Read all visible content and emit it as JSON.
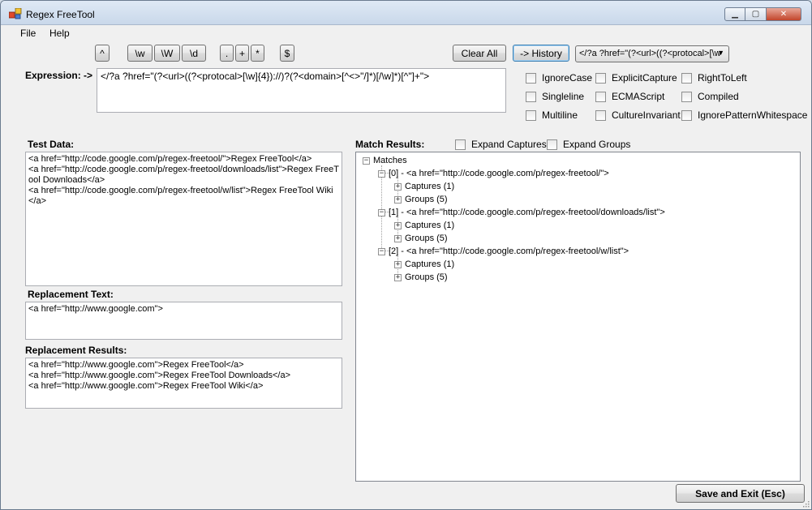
{
  "window": {
    "title": "Regex FreeTool"
  },
  "menu": {
    "file": "File",
    "help": "Help"
  },
  "toolbar": {
    "caret": "^",
    "word": "\\w",
    "nonword": "\\W",
    "digit": "\\d",
    "dot": ".",
    "plus": "+",
    "star": "*",
    "dollar": "$",
    "clear_all": "Clear All",
    "history": "-> History",
    "history_value": "</?a ?href=\"(?<url>((?<protocal>[\\w"
  },
  "expression": {
    "label": "Expression: ->",
    "value": "</?a ?href=\"(?<url>((?<protocal>[\\w]{4})://)?(?<domain>[^<>\"/]*)[/\\w]*)[^\"]+\">"
  },
  "options": {
    "ignore_case": "IgnoreCase",
    "explicit_capture": "ExplicitCapture",
    "right_to_left": "RightToLeft",
    "singleline": "Singleline",
    "ecmascript": "ECMAScript",
    "compiled": "Compiled",
    "multiline": "Multiline",
    "culture_invariant": "CultureInvariant",
    "ignore_pattern_whitespace": "IgnorePatternWhitespace"
  },
  "test_data": {
    "label": "Test Data:",
    "value": "<a href=\"http://code.google.com/p/regex-freetool/\">Regex FreeTool</a>\n<a href=\"http://code.google.com/p/regex-freetool/downloads/list\">Regex FreeTool Downloads</a>\n<a href=\"http://code.google.com/p/regex-freetool/w/list\">Regex FreeTool Wiki</a>"
  },
  "replacement_text": {
    "label": "Replacement Text:",
    "value": "<a href=\"http://www.google.com\">"
  },
  "replacement_results": {
    "label": "Replacement Results:",
    "value": "<a href=\"http://www.google.com\">Regex FreeTool</a>\n<a href=\"http://www.google.com\">Regex FreeTool Downloads</a>\n<a href=\"http://www.google.com\">Regex FreeTool Wiki</a>"
  },
  "match_results": {
    "label": "Match Results:",
    "expand_captures": "Expand Captures",
    "expand_groups": "Expand Groups",
    "root": "Matches",
    "matches": [
      {
        "label": "[0] - <a href=\"http://code.google.com/p/regex-freetool/\">",
        "captures": "Captures (1)",
        "groups": "Groups (5)"
      },
      {
        "label": "[1] - <a href=\"http://code.google.com/p/regex-freetool/downloads/list\">",
        "captures": "Captures (1)",
        "groups": "Groups (5)"
      },
      {
        "label": "[2] - <a href=\"http://code.google.com/p/regex-freetool/w/list\">",
        "captures": "Captures (1)",
        "groups": "Groups (5)"
      }
    ]
  },
  "footer": {
    "save_exit": "Save and Exit (Esc)"
  }
}
